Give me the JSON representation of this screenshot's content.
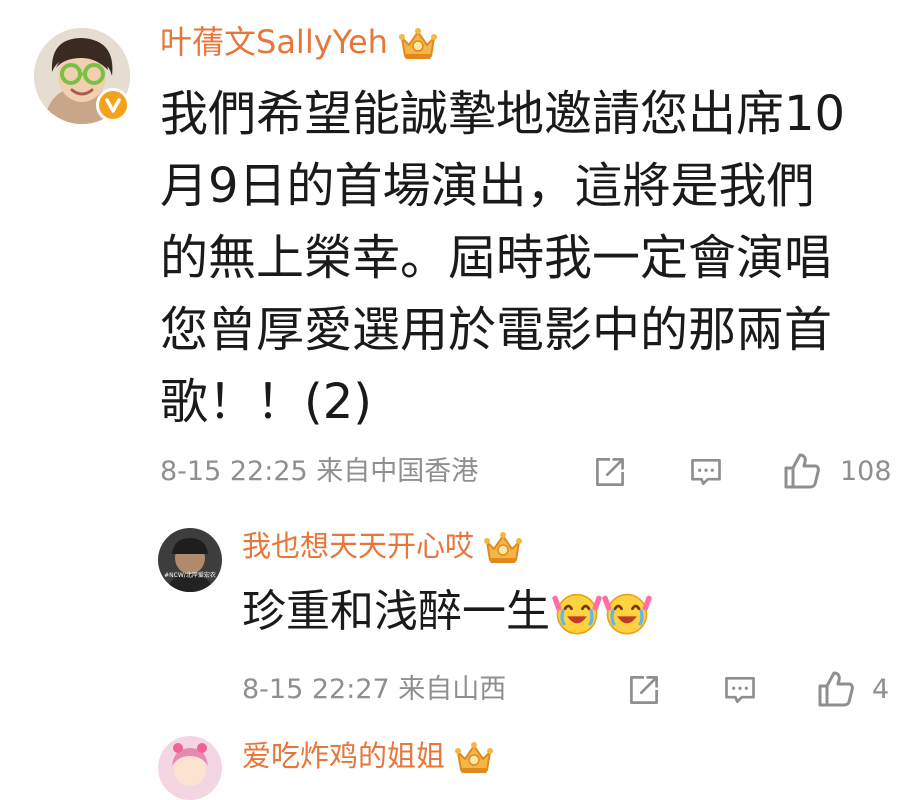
{
  "comments": [
    {
      "username": "叶蒨文SallyYeh",
      "verified": true,
      "avatar_icon": "woman-avatar-with-glasses",
      "body_lines": [
        "我們希望能誠摯地邀請您出席10",
        "月9日的首場演出，這將是我們",
        "的無上榮幸。屆時我一定會演唱",
        "您曾厚愛選用於電影中的那兩首",
        "歌！！(2)"
      ],
      "timestamp": "8-15 22:25",
      "location": "来自中国香港",
      "like_count": "108"
    },
    {
      "username": "我也想天天开心哎",
      "verified": false,
      "avatar_icon": "dark-cap-avatar",
      "avatar_caption": "#NCW/北岸爱宏农",
      "body_text": "珍重和浅醉一生",
      "emoji": [
        "cheering-emoji",
        "cheering-emoji"
      ],
      "timestamp": "8-15 22:27",
      "location": "来自山西",
      "like_count": "4"
    },
    {
      "username": "爱吃炸鸡的姐姐",
      "verified": false,
      "avatar_icon": "pink-cartoon-avatar"
    }
  ],
  "icons": {
    "share": "share-icon",
    "comment": "comment-icon",
    "like": "thumbs-up-icon",
    "crown": "crown-badge-icon",
    "verified": "verified-badge-icon"
  },
  "colors": {
    "username": "#e8763a",
    "body_text": "#1a1a1a",
    "meta_text": "#8f8f8f",
    "verified_badge": "#f5a21b",
    "crown": "#f2a93b"
  }
}
